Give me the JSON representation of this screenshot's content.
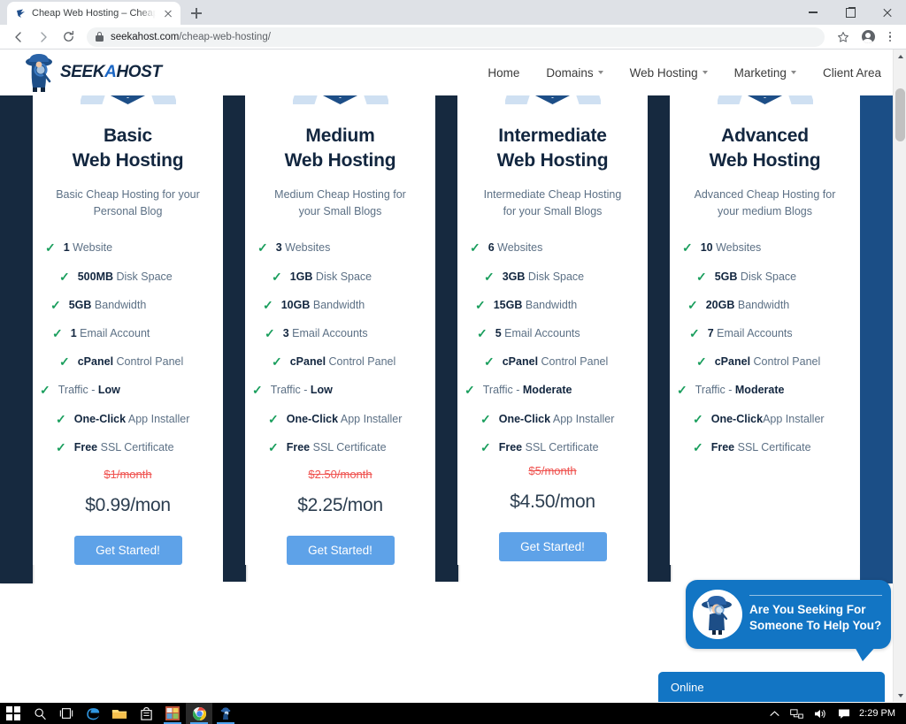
{
  "browser": {
    "tab": {
      "title": "Cheap Web Hosting – Cheapest Web Hosting",
      "favicon": "seekahost-favicon"
    },
    "new_tab_label": "+",
    "window_controls": {
      "minimize": "minimize-icon",
      "maximize": "maximize-icon",
      "close": "close-icon"
    },
    "nav": {
      "back": "back-arrow-icon",
      "forward": "forward-arrow-icon",
      "reload": "reload-icon"
    },
    "address": {
      "lock": "lock-icon",
      "domain": "seekahost.com",
      "path": "/cheap-web-hosting/"
    },
    "toolbar_right": {
      "bookmark": "star-icon",
      "profile": "profile-avatar-icon",
      "menu": "kebab-menu-icon"
    }
  },
  "site": {
    "logo": {
      "text_a": "SEEK",
      "text_hl": "A",
      "text_b": "HOST"
    },
    "nav": [
      {
        "label": "Home",
        "has_dropdown": false
      },
      {
        "label": "Domains",
        "has_dropdown": true
      },
      {
        "label": "Web Hosting",
        "has_dropdown": true
      },
      {
        "label": "Marketing",
        "has_dropdown": true
      },
      {
        "label": "Client Area",
        "has_dropdown": false
      }
    ]
  },
  "plans": [
    {
      "name": "Basic",
      "name_line2": "Web Hosting",
      "subtitle": "Basic Cheap Hosting for your Personal Blog",
      "features": [
        {
          "strong": "1",
          "rest": " Website"
        },
        {
          "strong": "500MB",
          "rest": " Disk Space"
        },
        {
          "strong": "5GB",
          "rest": " Bandwidth"
        },
        {
          "strong": "1",
          "rest": " Email Account"
        },
        {
          "strong": "cPanel",
          "rest": " Control Panel"
        },
        {
          "strong": "",
          "rest": "Traffic - ",
          "strong_after": "Low"
        },
        {
          "strong": "One-Click",
          "rest": " App Installer"
        },
        {
          "strong": "Free",
          "rest": " SSL Certificate"
        }
      ],
      "old_price": "$1/month",
      "new_price": "$0.99/mon",
      "cta": "Get Started!"
    },
    {
      "name": "Medium",
      "name_line2": "Web Hosting",
      "subtitle": "Medium Cheap Hosting for your Small Blogs",
      "features": [
        {
          "strong": "3",
          "rest": " Websites"
        },
        {
          "strong": "1GB",
          "rest": " Disk Space"
        },
        {
          "strong": "10GB",
          "rest": " Bandwidth"
        },
        {
          "strong": "3",
          "rest": " Email Accounts"
        },
        {
          "strong": "cPanel",
          "rest": " Control Panel"
        },
        {
          "strong": "",
          "rest": "Traffic - ",
          "strong_after": "Low"
        },
        {
          "strong": "One-Click",
          "rest": " App Installer"
        },
        {
          "strong": "Free",
          "rest": " SSL Certificate"
        }
      ],
      "old_price": "$2.50/month",
      "new_price": "$2.25/mon",
      "cta": "Get Started!"
    },
    {
      "name": "Intermediate",
      "name_line2": "Web Hosting",
      "subtitle": "Intermediate Cheap Hosting for your Small Blogs",
      "features": [
        {
          "strong": "6",
          "rest": " Websites"
        },
        {
          "strong": "3GB",
          "rest": " Disk Space"
        },
        {
          "strong": "15GB",
          "rest": " Bandwidth"
        },
        {
          "strong": "5",
          "rest": " Email Accounts"
        },
        {
          "strong": "cPanel",
          "rest": " Control Panel"
        },
        {
          "strong": "",
          "rest": "Traffic - ",
          "strong_after": "Moderate"
        },
        {
          "strong": "One-Click",
          "rest": " App Installer"
        },
        {
          "strong": "Free",
          "rest": " SSL Certificate"
        }
      ],
      "old_price": "$5/month",
      "new_price": "$4.50/mon",
      "cta": "Get Started!"
    },
    {
      "name": "Advanced",
      "name_line2": "Web Hosting",
      "subtitle": "Advanced Cheap Hosting for your medium Blogs",
      "features": [
        {
          "strong": "10",
          "rest": " Websites"
        },
        {
          "strong": "5GB",
          "rest": " Disk Space"
        },
        {
          "strong": "20GB",
          "rest": " Bandwidth"
        },
        {
          "strong": "7",
          "rest": " Email Accounts"
        },
        {
          "strong": "cPanel",
          "rest": " Control Panel"
        },
        {
          "strong": "",
          "rest": "Traffic - ",
          "strong_after": "Moderate"
        },
        {
          "strong": "One-Click",
          "rest": "App Installer"
        },
        {
          "strong": "Free",
          "rest": " SSL Certificate"
        }
      ],
      "old_price": "",
      "new_price": "",
      "cta": ""
    }
  ],
  "chat": {
    "message": "Are You Seeking For Someone To Help You?",
    "status": "Online",
    "avatar": "detective-avatar-icon"
  },
  "taskbar": {
    "start": "windows-start-icon",
    "items": [
      {
        "name": "search-icon"
      },
      {
        "name": "task-view-icon"
      },
      {
        "name": "edge-icon"
      },
      {
        "name": "file-explorer-icon"
      },
      {
        "name": "microsoft-store-icon"
      },
      {
        "name": "app-icon"
      },
      {
        "name": "chrome-icon"
      },
      {
        "name": "seekahost-app-icon"
      }
    ],
    "tray": {
      "overflow": "chevron-up-icon",
      "network": "network-icon",
      "volume": "volume-icon",
      "action_center": "action-center-icon"
    },
    "clock": "2:29 PM"
  },
  "colors": {
    "navy": "#16293f",
    "blue_bar": "#1b4e86",
    "accent_blue": "#5ea2e8",
    "chat_blue": "#1275c4",
    "tick_green": "#1a9e5d",
    "old_price_red": "#ef5350"
  }
}
